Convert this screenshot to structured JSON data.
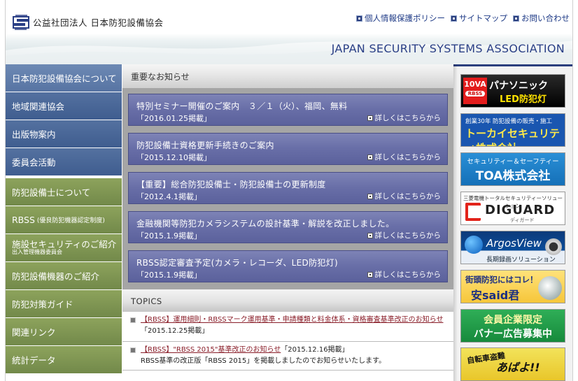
{
  "header": {
    "org_name": "公益社団法人 日本防犯設備協会",
    "tagline": "JAPAN SECURITY SYSTEMS ASSOCIATION",
    "links": [
      "個人情報保護ポリシー",
      "サイトマップ",
      "お問い合わせ"
    ]
  },
  "nav": {
    "items": [
      {
        "label": "日本防犯設備協会について"
      },
      {
        "label": "地域関連協会"
      },
      {
        "label": "出版物案内"
      },
      {
        "label": "委員会活動"
      },
      {
        "label": "防犯設備士について"
      },
      {
        "label": "RBSS",
        "sub": "(優良防犯機器認定制度)"
      },
      {
        "label": "施設セキュリティのご紹介",
        "sub": "出入管理機器委員会"
      },
      {
        "label": "防犯設備機器のご紹介"
      },
      {
        "label": "防犯対策ガイド"
      },
      {
        "label": "関連リンク"
      },
      {
        "label": "統計データ"
      }
    ]
  },
  "news": {
    "heading": "重要なお知らせ",
    "more_label": "詳しくはこちらから",
    "items": [
      {
        "title": "特別セミナー開催のご案内　３／１（火）、福岡、無料",
        "date": "「2016.01.25掲載」"
      },
      {
        "title": "防犯設備士資格更新手続きのご案内",
        "date": "「2015.12.10掲載」"
      },
      {
        "title": "【重要】総合防犯設備士・防犯設備士の更新制度",
        "date": "「2012.4.1掲載」"
      },
      {
        "title": "金融機関等防犯カメラシステムの設計基準・解説を改正しました。",
        "date": "「2015.1.9掲載」"
      },
      {
        "title": "RBSS認定審査予定(カメラ・レコーダ、LED防犯灯)",
        "date": "「2015.1.9掲載」"
      }
    ]
  },
  "topics": {
    "heading": "TOPICS",
    "items": [
      {
        "link": "【RBSS】運用細則・RBSSマーク運用基準・申請種類と料金体系・資格審査基準改正のお知らせ",
        "date": "「2015.12.25掲載」",
        "desc": ""
      },
      {
        "link": "【RBSS】\"RBSS 2015\"基準改正のお知らせ",
        "date": "「2015.12.16掲載」",
        "desc": "RBSS基準の改正版「RBSS 2015」を掲載しましたのでお知らせいたします。"
      }
    ]
  },
  "banners": {
    "panasonic": {
      "badge": "10VA",
      "badge_sub": "RBSS",
      "title": "パナソニック",
      "sub": "LED防犯灯"
    },
    "tokai": {
      "top": "創業30年 防犯設備の販売・施工",
      "name": "トーカイセキュリティ株式会社"
    },
    "toa": {
      "top": "セキュリティー＆セーフティー",
      "name": "TOA株式会社"
    },
    "diguard": {
      "top": "三菱電機トータルセキュリティーソリューション",
      "name": "DIGUARD",
      "kana": "ディガード"
    },
    "argos": {
      "name": "ArgosView",
      "sub": "長期録画ソリューション"
    },
    "anshin": {
      "top": "街頭防犯にはコレ！",
      "name": "安said君"
    },
    "recruit": {
      "line1": "会員企業限定",
      "line2": "バナー広告募集中"
    },
    "jitensha": {
      "left": "自転車盗難",
      "right": "あばよ!!"
    }
  },
  "colors": {
    "nav_blue": "#4a679a",
    "nav_green": "#7f9553",
    "news_purple": "#6a70a8",
    "header_text": "#2a3f86",
    "topic_link": "#8a1f2a"
  }
}
